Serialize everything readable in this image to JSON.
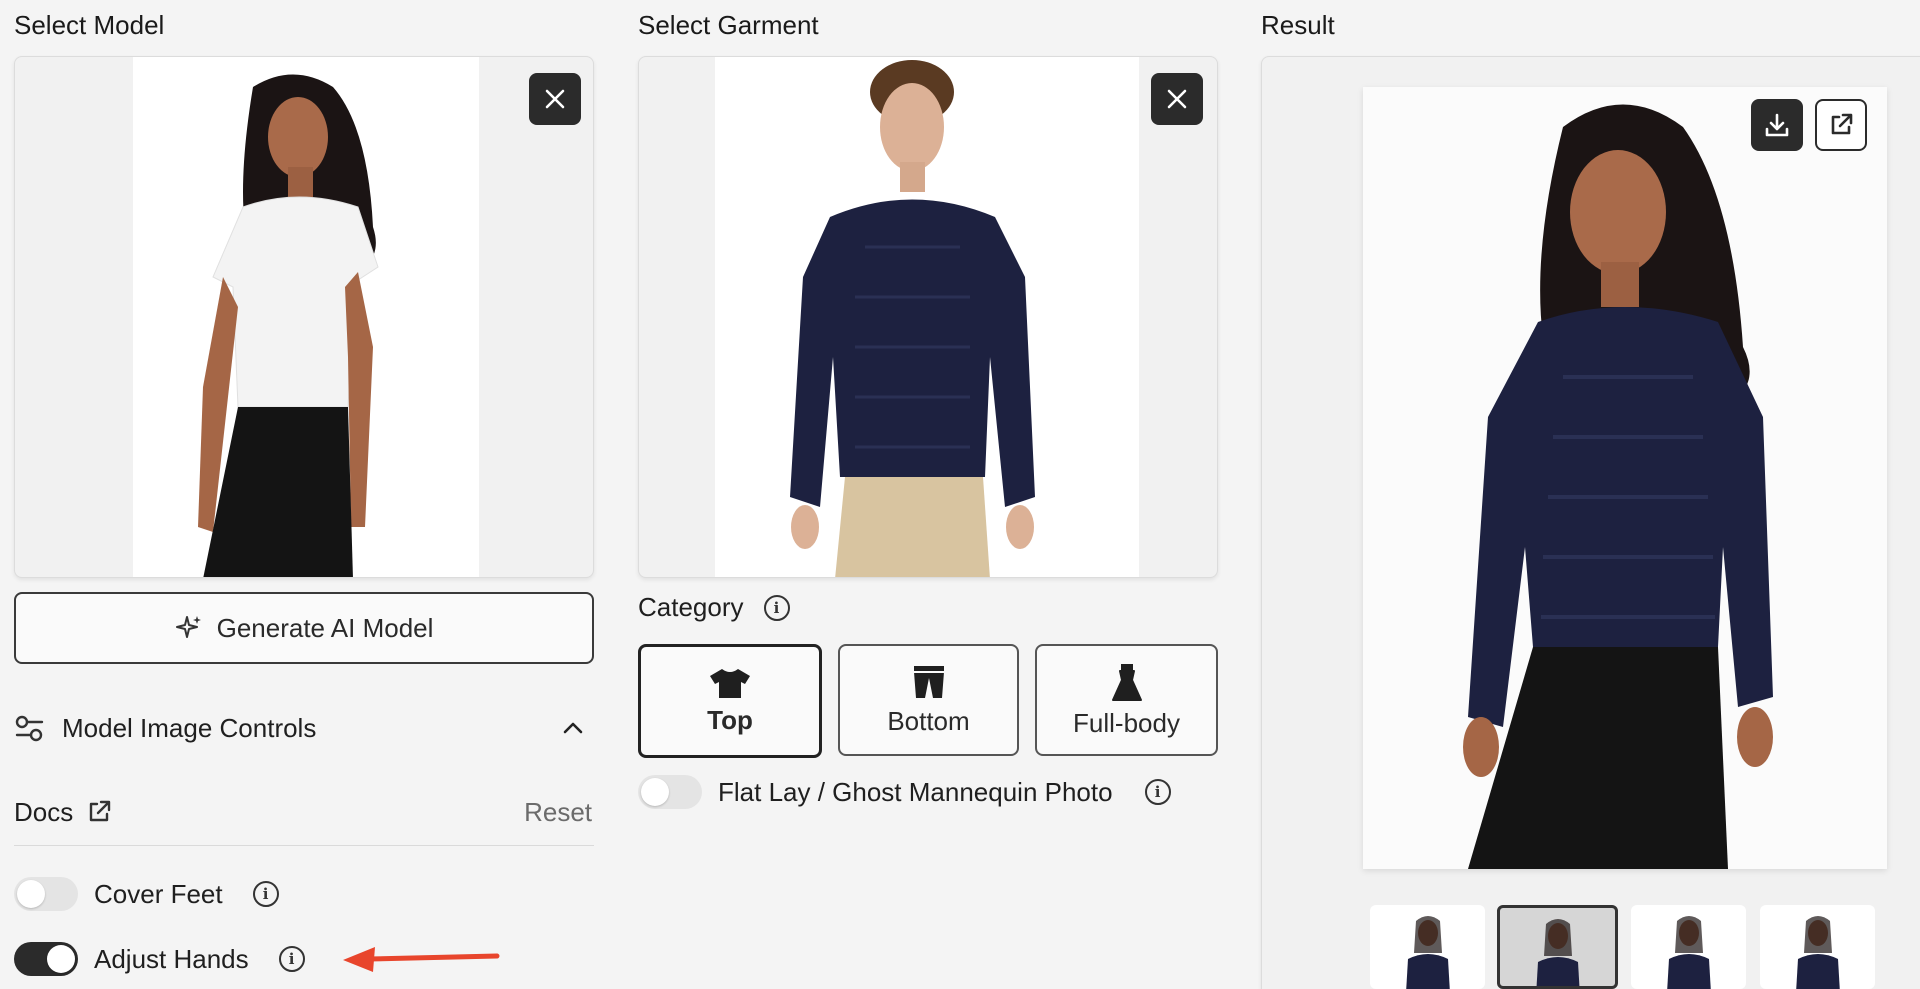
{
  "columns": {
    "model_title": "Select Model",
    "garment_title": "Select Garment",
    "result_title": "Result"
  },
  "model": {
    "generate_button": "Generate AI Model",
    "controls_title": "Model Image Controls",
    "docs_label": "Docs",
    "reset_label": "Reset",
    "toggles": [
      {
        "label": "Cover Feet",
        "on": false
      },
      {
        "label": "Adjust Hands",
        "on": true
      }
    ]
  },
  "garment": {
    "category_label": "Category",
    "categories": [
      {
        "label": "Top",
        "icon": "tshirt-icon",
        "active": true
      },
      {
        "label": "Bottom",
        "icon": "pants-icon",
        "active": false
      },
      {
        "label": "Full-body",
        "icon": "dress-icon",
        "active": false
      }
    ],
    "flat_lay_label": "Flat Lay / Ghost Mannequin Photo",
    "flat_lay_on": false
  },
  "result": {
    "thumbnails_count": 4,
    "active_thumbnail": 2
  },
  "colors": {
    "sweater": "#1d2140",
    "dark_button": "#2b2b2b",
    "annotation_arrow": "#e8452c"
  }
}
